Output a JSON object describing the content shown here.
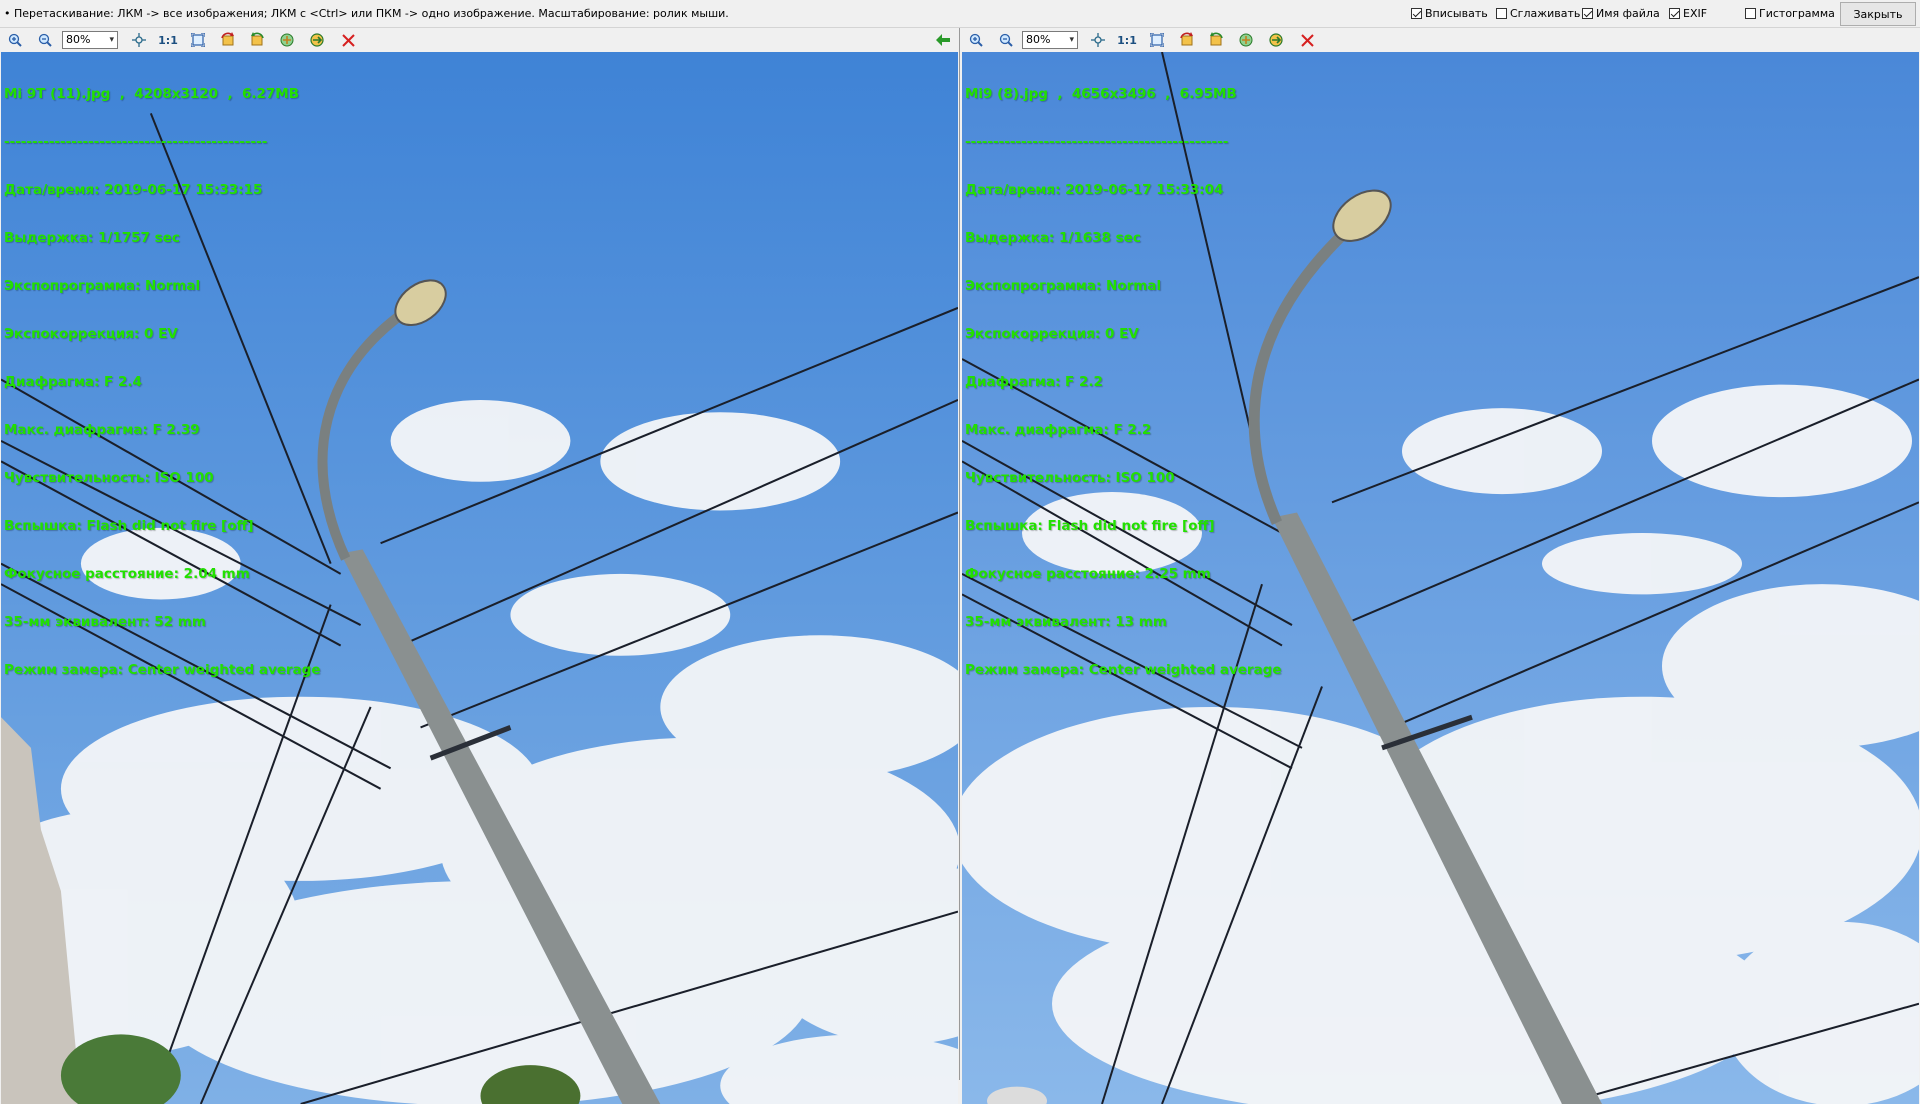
{
  "header": {
    "hint": "• Перетаскивание: ЛКМ -> все изображения; ЛКМ с <Ctrl> или ПКМ -> одно изображение. Масштабирование: ролик мыши.",
    "options": [
      {
        "label": "Вписывать",
        "checked": true
      },
      {
        "label": "Сглаживать",
        "checked": false
      },
      {
        "label": "Имя файла",
        "checked": true
      },
      {
        "label": "EXIF",
        "checked": true
      },
      {
        "label": "Гистограмма",
        "checked": false
      }
    ],
    "close_label": "Закрыть"
  },
  "panels": [
    {
      "zoom": "80%",
      "one_to_one": "1:1",
      "info": {
        "file": "Mi 9T (11).jpg  ,  4208x3120  ,  6.27MB",
        "separator": "-----------------------------------------------",
        "datetime": "Дата/время: 2019-06-17 15:33:15",
        "exposure": "Выдержка: 1/1757 sec",
        "program": "Экспопрограмма: Normal",
        "ev": "Экспокоррекция: 0 EV",
        "aperture": "Диафрагма: F 2.4",
        "max_aperture": "Макс. диафрагма: F 2.39",
        "iso": "Чувствительность: ISO 100",
        "flash": "Вспышка: Flash did not fire [off]",
        "focal": "Фокусное расстояние: 2.04 mm",
        "focal35": "35-мм эквивалент: 52 mm",
        "metering": "Режим замера: Center weighted average"
      }
    },
    {
      "zoom": "80%",
      "one_to_one": "1:1",
      "info": {
        "file": "Mi9 (8).jpg  ,  4656x3496  ,  6.95MB",
        "separator": "-----------------------------------------------",
        "datetime": "Дата/время: 2019-06-17 15:33:04",
        "exposure": "Выдержка: 1/1638 sec",
        "program": "Экспопрограмма: Normal",
        "ev": "Экспокоррекция: 0 EV",
        "aperture": "Диафрагма: F 2.2",
        "max_aperture": "Макс. диафрагма: F 2.2",
        "iso": "Чувствительность: ISO 100",
        "flash": "Вспышка: Flash did not fire [off]",
        "focal": "Фокусное расстояние: 2.25 mm",
        "focal35": "35-мм эквивалент: 13 mm",
        "metering": "Режим замера: Center weighted average"
      }
    }
  ],
  "colors": {
    "osd_text": "#22e000",
    "sky_top": "#3f83d6",
    "sky_bottom": "#7fb0e6",
    "cloud": "#f4f6f8",
    "pole": "#8a9090",
    "close_icon": "#d62020"
  }
}
